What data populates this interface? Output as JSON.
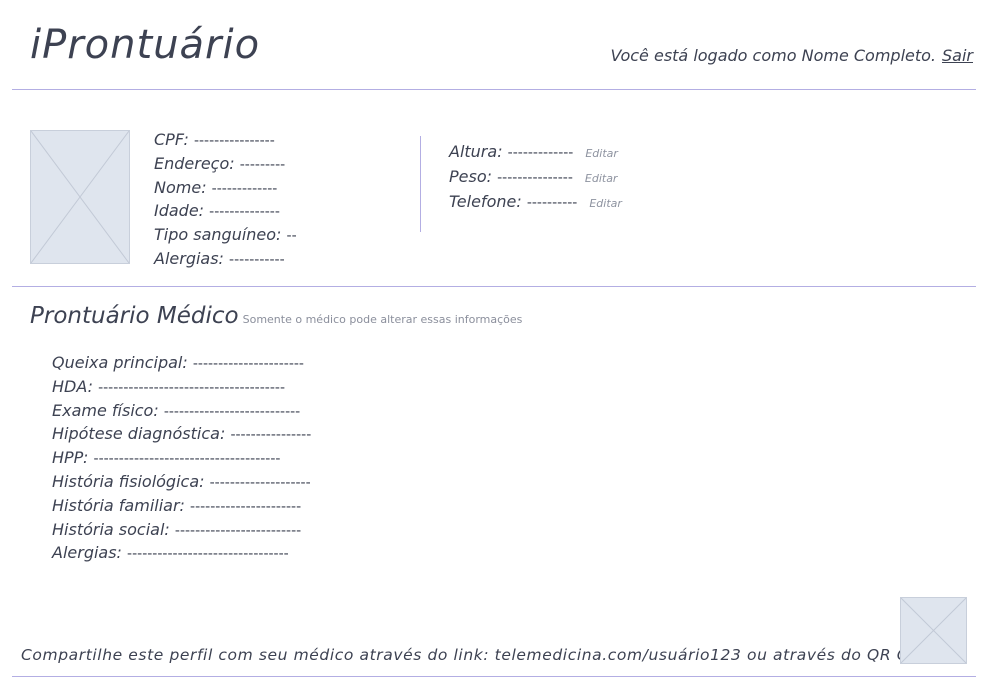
{
  "header": {
    "app_title": "iProntuário",
    "session_text": "Você está logado como Nome Completo.",
    "logout_label": "Sair"
  },
  "patient": {
    "photo_icon": "image-placeholder-icon",
    "fields_left": [
      {
        "label": "CPF:",
        "value": "----------------"
      },
      {
        "label": "Endereço:",
        "value": "---------"
      },
      {
        "label": "Nome:",
        "value": "-------------"
      },
      {
        "label": "Idade:",
        "value": "--------------"
      },
      {
        "label": "Tipo sanguíneo:",
        "value": "--"
      },
      {
        "label": "Alergias:",
        "value": "-----------"
      }
    ],
    "fields_right": [
      {
        "label": "Altura:",
        "value": "-------------",
        "action": "Editar"
      },
      {
        "label": "Peso:",
        "value": "---------------",
        "action": "Editar"
      },
      {
        "label": "Telefone:",
        "value": "----------",
        "action": "Editar"
      }
    ]
  },
  "medical_record": {
    "title": "Prontuário Médico",
    "note": "Somente o médico pode alterar essas informações",
    "items": [
      {
        "label": "Queixa principal:",
        "value": "----------------------"
      },
      {
        "label": "HDA:",
        "value": "-------------------------------------"
      },
      {
        "label": "Exame físico:",
        "value": "---------------------------"
      },
      {
        "label": "Hipótese diagnóstica:",
        "value": "----------------"
      },
      {
        "label": "HPP:",
        "value": "-------------------------------------"
      },
      {
        "label": "História fisiológica:",
        "value": "--------------------"
      },
      {
        "label": "História familiar:",
        "value": "----------------------"
      },
      {
        "label": "História social:",
        "value": "-------------------------"
      },
      {
        "label": "Alergias:",
        "value": "--------------------------------"
      }
    ]
  },
  "footer": {
    "share_text": "Compartilhe este perfil com seu médico através do link: telemedicina.com/usuário123 ou através do QR Code",
    "qr_icon": "qr-code-placeholder-icon"
  },
  "colors": {
    "text": "#3d4252",
    "divider": "#b3aee3",
    "placeholder_fill": "#dfe5ee",
    "muted": "#8e93a0"
  }
}
